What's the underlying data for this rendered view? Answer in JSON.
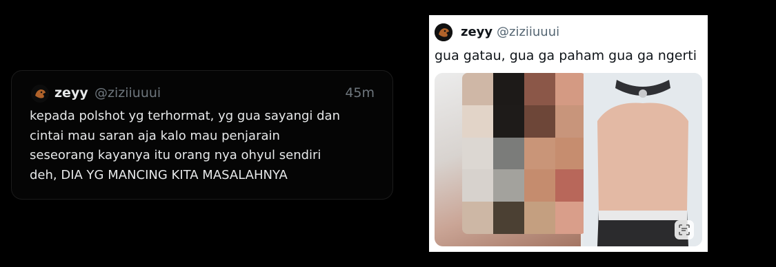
{
  "tweet": {
    "display_name": "zeyy",
    "handle": "@ziziiuuui",
    "time": "45m",
    "text": "kepada polshot yg terhormat, yg gua sayangi dan\ncintai mau saran aja kalo mau penjarain\nseseorang kayanya itu orang nya ohyul sendiri\ndeh, DIA YG MANCING KITA MASALAHNYA"
  },
  "quoted_screenshot": {
    "display_name": "zeyy",
    "handle": "@ziziiuuui",
    "text": "gua gatau, gua ga paham gua ga ngerti"
  },
  "colors": {
    "background": "#000000",
    "text_primary": "#e7e9ea",
    "text_secondary": "#6e767d"
  },
  "icons": [
    "avatar-icon",
    "scan-text-icon"
  ]
}
